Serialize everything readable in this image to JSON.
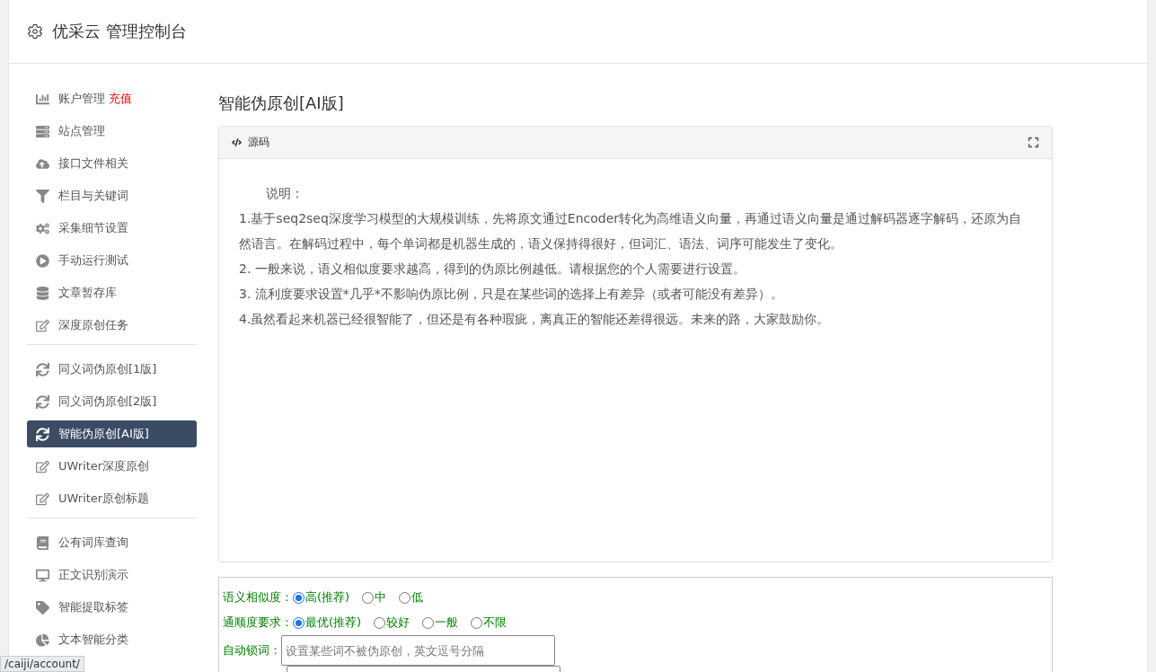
{
  "header": {
    "title": "优采云 管理控制台"
  },
  "sidebar": {
    "groups": [
      {
        "items": [
          {
            "label": "账户管理",
            "badge": "充值",
            "selected": false
          },
          {
            "label": "站点管理",
            "selected": false
          },
          {
            "label": "接口文件相关",
            "selected": false
          },
          {
            "label": "栏目与关键词",
            "selected": false
          },
          {
            "label": "采集细节设置",
            "selected": false
          },
          {
            "label": "手动运行测试",
            "selected": false
          },
          {
            "label": "文章暂存库",
            "selected": false
          },
          {
            "label": "深度原创任务",
            "selected": false
          }
        ]
      },
      {
        "items": [
          {
            "label": "同义词伪原创[1版]",
            "selected": false
          },
          {
            "label": "同义词伪原创[2版]",
            "selected": false
          },
          {
            "label": "智能伪原创[AI版]",
            "selected": true
          },
          {
            "label": "UWriter深度原创",
            "selected": false
          },
          {
            "label": "UWriter原创标题",
            "selected": false
          }
        ]
      },
      {
        "items": [
          {
            "label": "公有词库查询",
            "selected": false
          },
          {
            "label": "正文识别演示",
            "selected": false
          },
          {
            "label": "智能提取标签",
            "selected": false
          },
          {
            "label": "文本智能分类",
            "selected": false
          }
        ]
      }
    ]
  },
  "main": {
    "title": "智能伪原创[AI版]",
    "panel": {
      "tab": "源码",
      "lines": [
        "说明：",
        "1.基于seq2seq深度学习模型的大规模训练，先将原文通过Encoder转化为高维语义向量，再通过语义向量是通过解码器逐字解码，还原为自然语言。在解码过程中，每个单词都是机器生成的，语义保持得很好，但词汇、语法、词序可能发生了变化。",
        "2. 一般来说，语义相似度要求越高，得到的伪原比例越低。请根据您的个人需要进行设置。",
        "3. 流利度要求设置*几乎*不影响伪原比例，只是在某些词的选择上有差异（或者可能没有差异）。",
        "4.虽然看起来机器已经很智能了，但还是有各种瑕疵，离真正的智能还差得很远。未来的路，大家鼓励你。"
      ]
    },
    "options": [
      {
        "kind": "radio",
        "label": "语义相似度：",
        "choices": [
          {
            "label": "高(推荐)",
            "selected": true
          },
          {
            "label": "中",
            "selected": false
          },
          {
            "label": "低",
            "selected": false
          }
        ]
      },
      {
        "kind": "radio",
        "label": "通顺度要求：",
        "choices": [
          {
            "label": "最优(推荐)",
            "selected": true
          },
          {
            "label": "较好",
            "selected": false
          },
          {
            "label": "一般",
            "selected": false
          },
          {
            "label": "不限",
            "selected": false
          }
        ]
      },
      {
        "kind": "text",
        "label": "自动锁词：",
        "placeholder": "设置某些词不被伪原创，英文逗号分隔"
      }
    ]
  },
  "status_url": "/caiji/account/"
}
